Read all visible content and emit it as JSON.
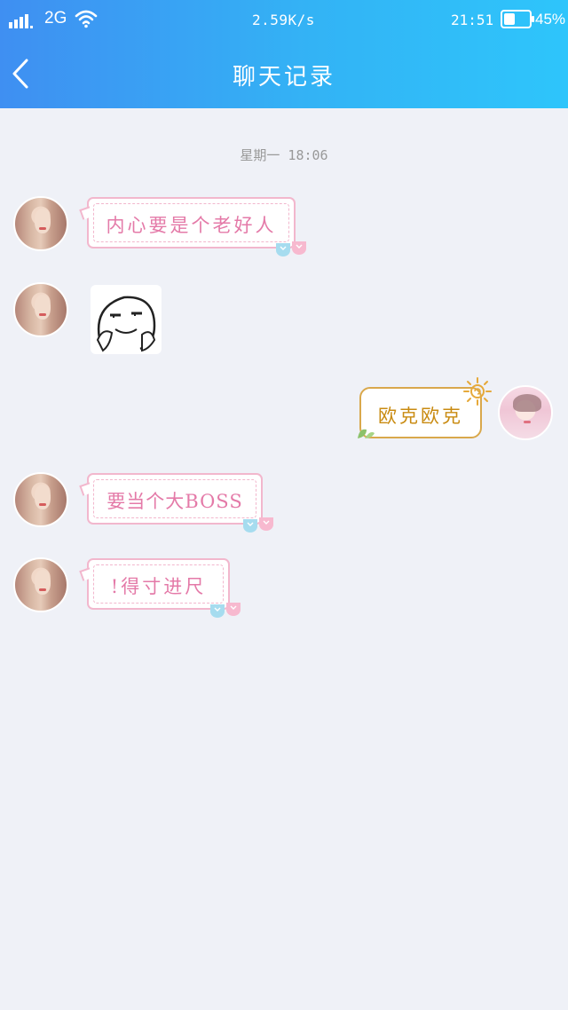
{
  "status_bar": {
    "network_type": "2G",
    "net_speed": "2.59K/s",
    "time": "21:51",
    "battery_percent": "45%",
    "battery_level": 0.45,
    "icons": [
      "signal-icon",
      "wifi-icon",
      "battery-icon"
    ]
  },
  "header": {
    "title": "聊天记录",
    "back_icon": "chevron-left-icon"
  },
  "chat": {
    "timestamp": "星期一 18:06",
    "messages": [
      {
        "sender": "friend",
        "type": "text",
        "text": "内心要是个老好人"
      },
      {
        "sender": "friend",
        "type": "sticker",
        "sticker": "smirking-face-sticker"
      },
      {
        "sender": "me",
        "type": "text",
        "text": "欧克欧克"
      },
      {
        "sender": "friend",
        "type": "text",
        "text": "要当个大BOSS"
      },
      {
        "sender": "friend",
        "type": "text",
        "text": "!得寸进尺"
      }
    ]
  },
  "colors": {
    "header_gradient_start": "#3f8ff2",
    "header_gradient_end": "#2ec5fb",
    "background": "#eff1f7",
    "friend_bubble_text": "#e47aa8",
    "friend_bubble_border": "#f2b7cd",
    "my_bubble_text": "#c98b12",
    "my_bubble_border": "#d9a84c"
  }
}
